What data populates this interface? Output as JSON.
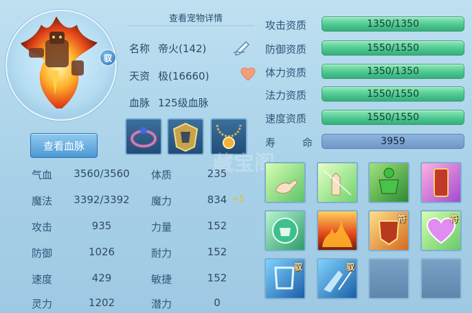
{
  "header": {
    "title": "查看宠物详情"
  },
  "pet": {
    "name_label": "名称",
    "name_value": "帝火(142)",
    "talent_label": "天资",
    "talent_value": "极(16660)",
    "bloodline_label": "血脉",
    "bloodline_value": "125级血脉",
    "tag": "驭"
  },
  "actions": {
    "view_bloodline": "查看血脉"
  },
  "stats": [
    {
      "label": "气血",
      "value": "3560/3560"
    },
    {
      "label": "魔法",
      "value": "3392/3392"
    },
    {
      "label": "攻击",
      "value": "935"
    },
    {
      "label": "防御",
      "value": "1026"
    },
    {
      "label": "速度",
      "value": "429"
    },
    {
      "label": "灵力",
      "value": "1202"
    }
  ],
  "attributes": [
    {
      "label": "体质",
      "value": "235",
      "bonus": ""
    },
    {
      "label": "魔力",
      "value": "834",
      "bonus": "+5"
    },
    {
      "label": "力量",
      "value": "152",
      "bonus": ""
    },
    {
      "label": "耐力",
      "value": "152",
      "bonus": ""
    },
    {
      "label": "敏捷",
      "value": "152",
      "bonus": ""
    },
    {
      "label": "潜力",
      "value": "0",
      "bonus": ""
    }
  ],
  "aptitudes": [
    {
      "label": "攻击资质",
      "value": "1350/1350"
    },
    {
      "label": "防御资质",
      "value": "1550/1550"
    },
    {
      "label": "体力资质",
      "value": "1350/1350"
    },
    {
      "label": "法力资质",
      "value": "1550/1550"
    },
    {
      "label": "速度资质",
      "value": "1550/1550"
    }
  ],
  "lifespan": {
    "label_1": "寿",
    "label_2": "命",
    "value": "3959"
  },
  "skills": [
    {
      "name": "skill-1",
      "tag": ""
    },
    {
      "name": "skill-2",
      "tag": ""
    },
    {
      "name": "skill-3",
      "tag": ""
    },
    {
      "name": "skill-4",
      "tag": ""
    },
    {
      "name": "skill-5",
      "tag": ""
    },
    {
      "name": "skill-6",
      "tag": ""
    },
    {
      "name": "skill-7",
      "tag": "符"
    },
    {
      "name": "skill-8",
      "tag": "符"
    },
    {
      "name": "skill-9",
      "tag": "驭"
    },
    {
      "name": "skill-10",
      "tag": "驭"
    }
  ],
  "watermark": "藏宝阁",
  "colors": {
    "aptitude_bar": "#49c58d",
    "bonus": "#d9c230",
    "panel_bg": "#b4d9ee"
  }
}
